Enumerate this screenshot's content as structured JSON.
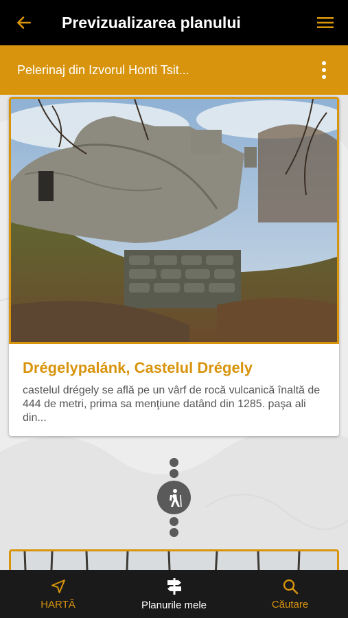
{
  "header": {
    "title": "Previzualizarea planului",
    "back_icon": "arrow-left-icon",
    "menu_icon": "hamburger-menu-icon"
  },
  "plan": {
    "title": "Pelerinaj din Izvorul Honti Tsit...",
    "more_icon": "more-vertical-icon"
  },
  "stops": [
    {
      "title": "Drégelypalánk, Castelul Drégely",
      "description": "castelul drégely se află pe un vârf de rocă vulcanică înaltă de 444 de metri, prima sa menţiune datând din 1285. paşa ali din..."
    }
  ],
  "connector": {
    "icon": "hiking-icon"
  },
  "bottom_nav": [
    {
      "label": "HARTĂ",
      "icon": "navigation-arrow-icon",
      "active": false
    },
    {
      "label": "Planurile mele",
      "icon": "signpost-icon",
      "active": true
    },
    {
      "label": "Căutare",
      "icon": "search-icon",
      "active": false
    }
  ],
  "colors": {
    "accent": "#d8940c",
    "topbar": "#000000",
    "nav": "#1a1a1a"
  }
}
